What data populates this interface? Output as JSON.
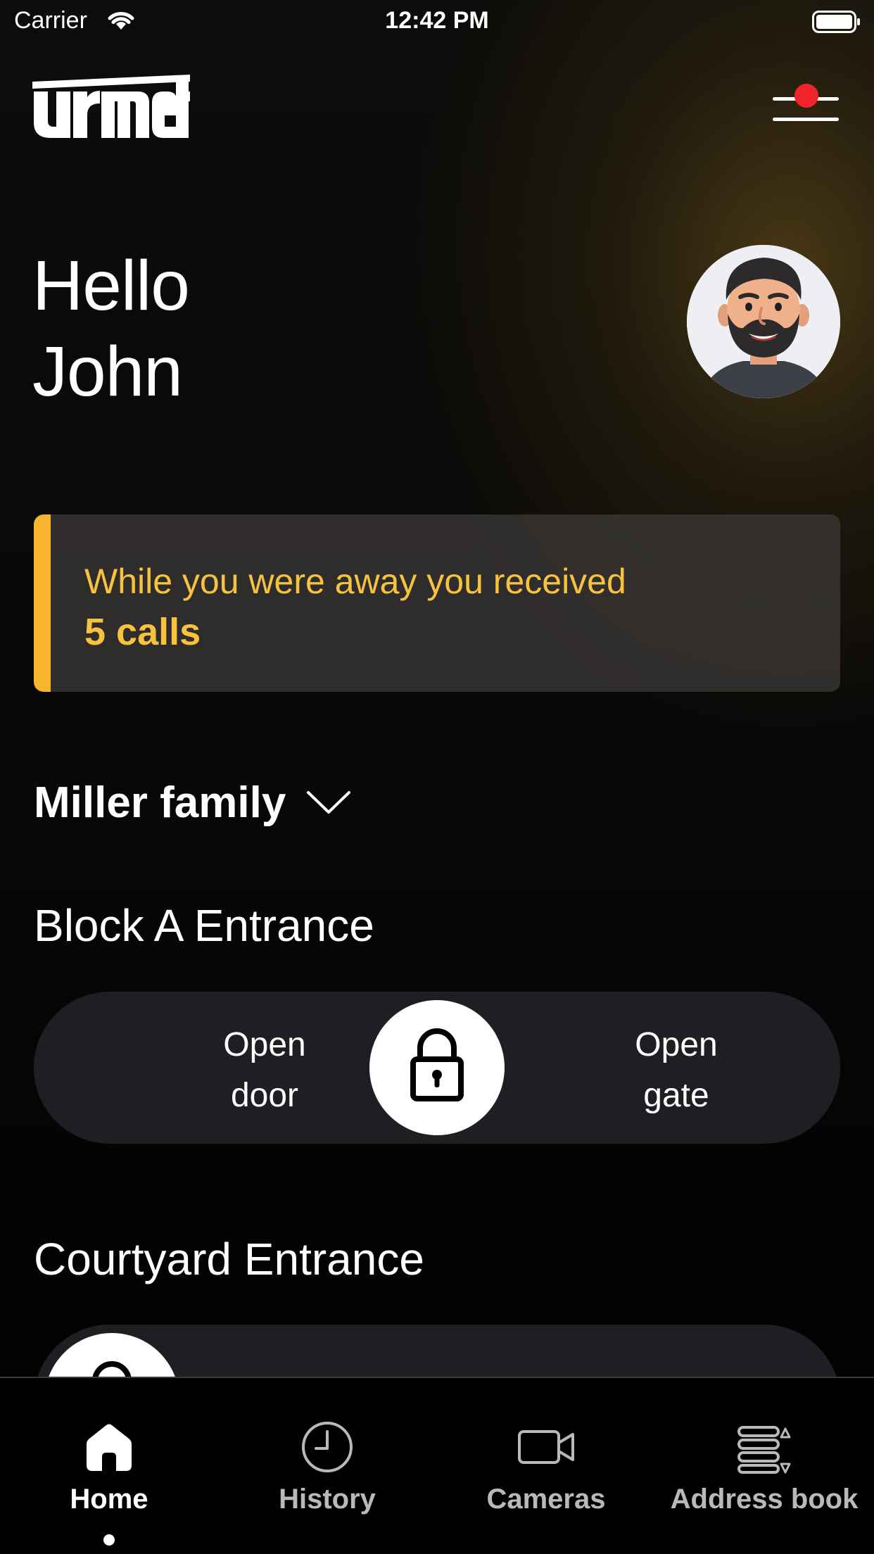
{
  "status_bar": {
    "carrier": "Carrier",
    "time": "12:42 PM",
    "wifi_icon": "wifi-icon",
    "battery_icon": "battery-full-icon"
  },
  "header": {
    "logo_text": "urmet",
    "menu_icon": "menu-with-notification-icon",
    "notification_dot_color": "#f0242a"
  },
  "greeting": {
    "line1": "Hello",
    "line2": "John"
  },
  "calls_card": {
    "message": "While you were away you received",
    "count_label": "5 calls",
    "accent_color": "#f7b52c"
  },
  "family_selector": {
    "label": "Miller family",
    "icon": "chevron-down-icon"
  },
  "entrances": [
    {
      "title": "Block A Entrance",
      "left_option": [
        "Open",
        "door"
      ],
      "right_option": [
        "Open",
        "gate"
      ],
      "knob_icon": "lock-icon"
    },
    {
      "title": "Courtyard Entrance",
      "knob_icon": "lock-icon"
    }
  ],
  "tab_bar": {
    "tabs": [
      {
        "label": "Home",
        "icon": "home-icon",
        "active": true
      },
      {
        "label": "History",
        "icon": "clock-icon",
        "active": false
      },
      {
        "label": "Cameras",
        "icon": "video-camera-icon",
        "active": false
      },
      {
        "label": "Address book",
        "icon": "address-book-icon",
        "active": false
      }
    ]
  }
}
